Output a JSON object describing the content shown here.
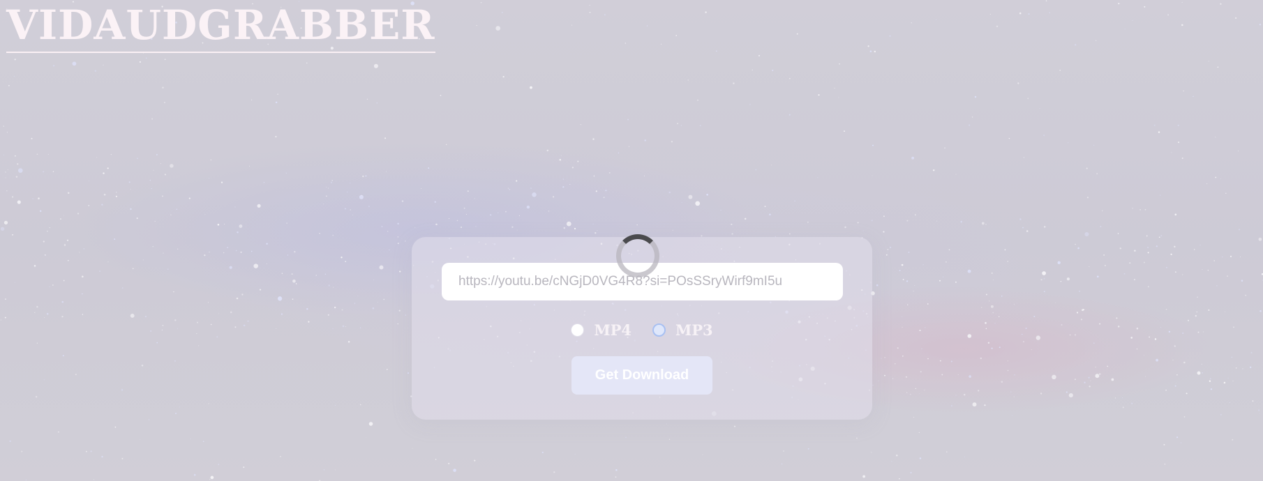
{
  "header": {
    "logo_text": "VIDAUDGRABBER"
  },
  "form": {
    "url_value": "https://youtu.be/cNGjD0VG4R8?si=POsSSryWirf9mI5u",
    "formats": [
      {
        "label": "MP4",
        "selected": false
      },
      {
        "label": "MP3",
        "selected": true
      }
    ],
    "submit_label": "Get Download",
    "loading": true
  },
  "colors": {
    "logo": "#fbf2f6",
    "button_bg": "#e4e6f7",
    "spinner_arc": "#4a4a4d",
    "selected_radio_ring": "#a8c0f2"
  }
}
